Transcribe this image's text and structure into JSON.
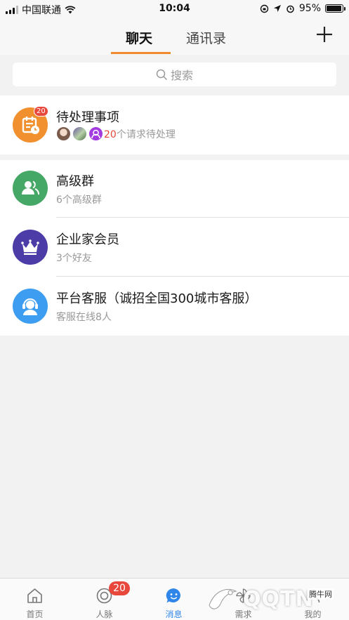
{
  "status_bar": {
    "carrier": "中国联通",
    "time": "10:04",
    "battery": "95%",
    "battery_level": 0.95
  },
  "header": {
    "tabs": [
      {
        "label": "聊天",
        "active": true
      },
      {
        "label": "通讯录",
        "active": false
      }
    ],
    "add_icon": "plus-icon"
  },
  "search": {
    "placeholder": "搜索",
    "icon": "search-icon"
  },
  "pending": {
    "title": "待处理事项",
    "badge": "20",
    "count": "20",
    "suffix": "个请求待处理",
    "icon": "calendar-clock-icon",
    "color": "#f0902e"
  },
  "list": [
    {
      "title": "高级群",
      "subtitle": "6个高级群",
      "icon": "group-icon",
      "color": "#45a866"
    },
    {
      "title": "企业家会员",
      "subtitle": "3个好友",
      "icon": "crown-icon",
      "color": "#4b3ca8"
    },
    {
      "title": "平台客服（诚招全国300城市客服）",
      "subtitle": "客服在线8人",
      "icon": "headset-icon",
      "color": "#3d9df0"
    }
  ],
  "tabbar": {
    "items": [
      {
        "label": "首页",
        "icon": "home-icon"
      },
      {
        "label": "人脉",
        "icon": "network-icon",
        "badge": "20"
      },
      {
        "label": "消息",
        "icon": "chat-smile-icon",
        "active": true
      },
      {
        "label": "需求",
        "icon": "pinwheel-icon"
      },
      {
        "label": "我的",
        "icon": "profile-icon"
      }
    ]
  },
  "watermark": {
    "text": "QQTN",
    "small": "腾牛网"
  },
  "colors": {
    "accent": "#f08a2c",
    "active_tab": "#2f86e8",
    "badge": "#e8473c"
  }
}
